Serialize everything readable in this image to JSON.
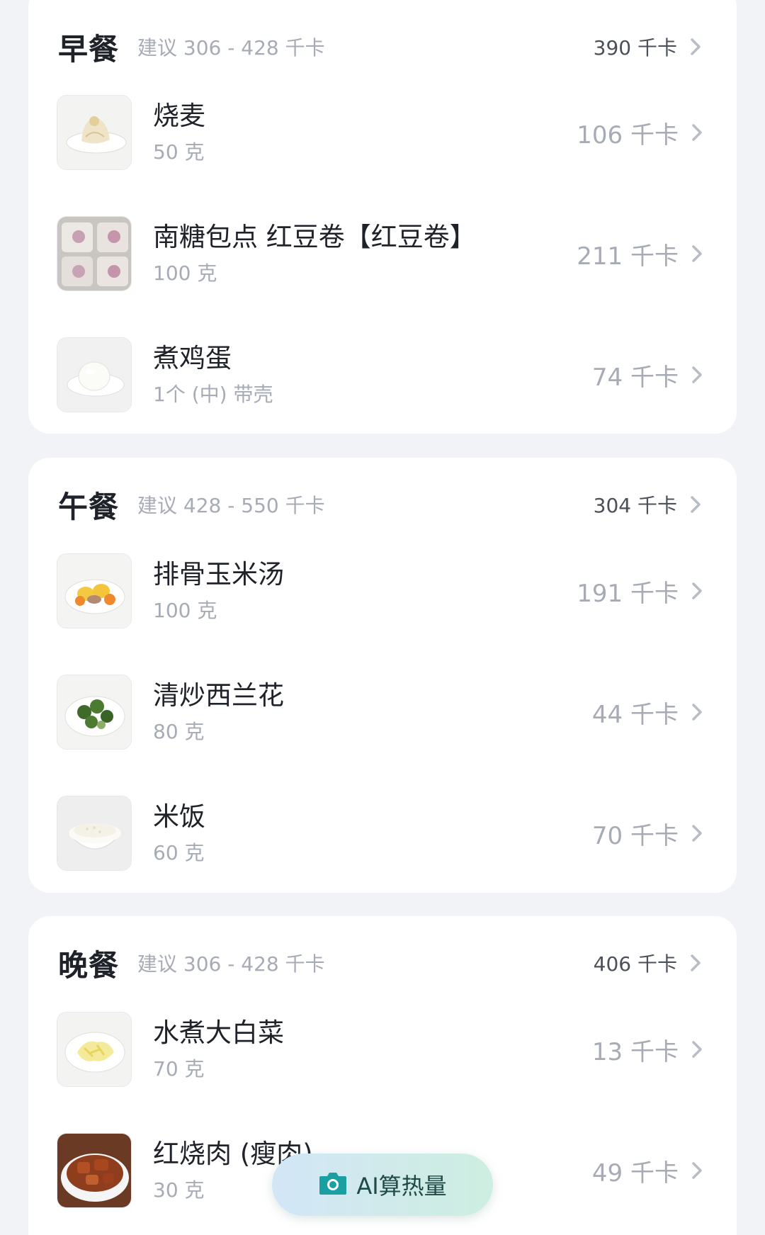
{
  "meals": [
    {
      "title": "早餐",
      "suggest": "建议 306 - 428 千卡",
      "total": "390 千卡",
      "items": [
        {
          "name": "烧麦",
          "amount": "50 克",
          "kcal": "106 千卡",
          "icon": "shaomai-photo"
        },
        {
          "name": "南糖包点 红豆卷【红豆卷】",
          "amount": "100 克",
          "kcal": "211 千卡",
          "icon": "red-bean-roll-photo"
        },
        {
          "name": "煮鸡蛋",
          "amount": "1个 (中) 带壳",
          "kcal": "74 千卡",
          "icon": "boiled-egg-photo"
        }
      ]
    },
    {
      "title": "午餐",
      "suggest": "建议 428 - 550 千卡",
      "total": "304 千卡",
      "items": [
        {
          "name": "排骨玉米汤",
          "amount": "100 克",
          "kcal": "191 千卡",
          "icon": "rib-corn-soup-photo"
        },
        {
          "name": "清炒西兰花",
          "amount": "80 克",
          "kcal": "44 千卡",
          "icon": "broccoli-photo"
        },
        {
          "name": "米饭",
          "amount": "60 克",
          "kcal": "70 千卡",
          "icon": "rice-photo"
        }
      ]
    },
    {
      "title": "晚餐",
      "suggest": "建议 306 - 428 千卡",
      "total": "406 千卡",
      "items": [
        {
          "name": "水煮大白菜",
          "amount": "70 克",
          "kcal": "13 千卡",
          "icon": "cabbage-photo"
        },
        {
          "name": "红烧肉 (瘦肉)",
          "amount": "30 克",
          "kcal": "49 千卡",
          "icon": "braised-pork-photo"
        }
      ]
    }
  ],
  "ai_button": {
    "label": "AI算热量",
    "icon": "camera-icon",
    "color": "#1aa0a0"
  }
}
